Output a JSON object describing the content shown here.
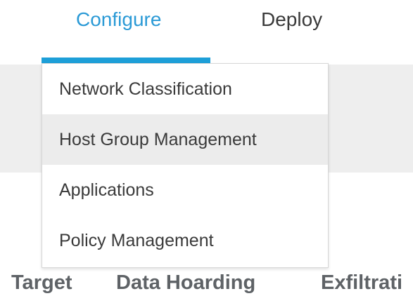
{
  "nav": {
    "tabs": [
      {
        "label": "Configure",
        "active": true
      },
      {
        "label": "Deploy",
        "active": false
      }
    ],
    "accent_color": "#1d9fd8"
  },
  "dropdown": {
    "items": [
      {
        "label": "Network Classification",
        "highlighted": false
      },
      {
        "label": "Host Group Management",
        "highlighted": true
      },
      {
        "label": "Applications",
        "highlighted": false
      },
      {
        "label": "Policy Management",
        "highlighted": false
      }
    ]
  },
  "bottom_labels": [
    "Target",
    "Data Hoarding",
    "Exfiltrati"
  ]
}
